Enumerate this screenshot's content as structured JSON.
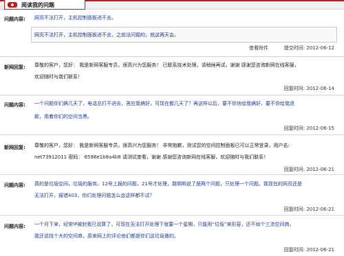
{
  "header": {
    "title": "阅读我的问题"
  },
  "question1": {
    "label": "问题内容:",
    "title": "网页不法打开，主机控制面板进不去。",
    "body": "网页不法打开，主机控制面板进不去，之前没问题的，就这两天会。",
    "attachment": "查看附件",
    "time": "提交时间: 2012-06-12"
  },
  "reply1": {
    "label": "新网回复:",
    "line1": "尊敬的客户，您好：  我是新网客服专员，很高兴为您服务！  已联系技术处理，请稍候再试，谢谢  感谢您咨询新网在线客服，",
    "line2": "欢迎随时与我们联系！",
    "time": "回复时间: 2012-06-14"
  },
  "question2": {
    "label": "问题内容:",
    "line1": "一个问题你们搞几天了，电话总打不进去，答应我搞好，可现在都几天了？再这样以后，要不你快给我搞好，要不你给我退",
    "line2": "款，用着你们的空间当黑。",
    "time": "回复时间: 2012-06-15"
  },
  "reply2": {
    "label": "新网回复:",
    "line1": "尊敬的客户，您好：  我是新网客服专员，很高兴为您服务！  非常抱歉，测试您的空间控制面板已可以正常登录，用户名:",
    "line2": "net73912011  密码：  6598e1b8a4b8 请测试查看，谢谢  感谢您咨询新网在线客服，欢迎随时与我们联系！",
    "time": "回复时间: 2012-06-21"
  },
  "question3": {
    "label": "问题内容:",
    "line1": "真的是垃圾空间，垃圾的服务。12号上报的问题，21号才处理，我明明说了是两个问题，只处理一个问题。我现在的网页还是",
    "line2": "无法打开，报错403，你们处理问题怎么会这样都不试？",
    "time": "回复时间: 2012-06-21"
  },
  "question4": {
    "label": "问题内容:",
    "line1": "一个月下来，经常IP被封我已说算了，可现在无法打开处理下就要一个星期，只能用“垃圾”来形容，还不如个三流空间商。",
    "line2": "我还说找个大的空间商，原来网上的评论他们都是你们这垃圾做的。",
    "time": "回复时间: 2012-06-21"
  }
}
